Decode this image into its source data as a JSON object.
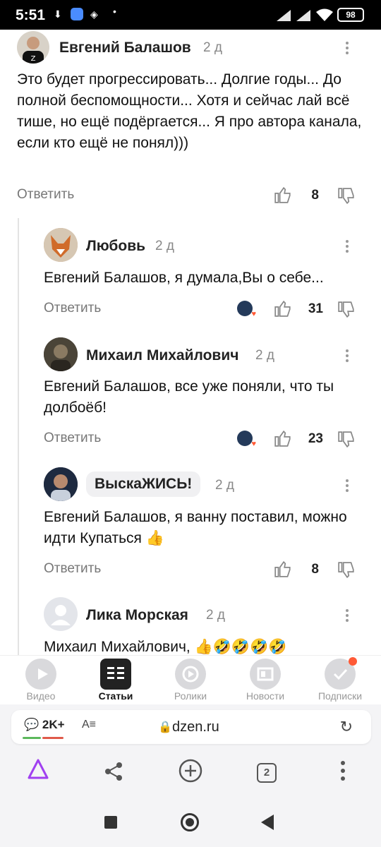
{
  "status_bar": {
    "time": "5:51",
    "battery": "98"
  },
  "comments": [
    {
      "author": "Евгений Балашов",
      "age": "2 д",
      "text": "Это будет прогрессировать... Долгие годы... До полной беспомощности... Хотя и сейчас лай всё тише, но ещё подёргается... Я про автора канала, если кто ещё не понял)))",
      "reply": "Ответить",
      "likes": "8"
    },
    {
      "author": "Любовь",
      "age": "2 д",
      "text": "Евгений Балашов, я думала,Вы о себе...",
      "reply": "Ответить",
      "likes": "31"
    },
    {
      "author": "Михаил Михайлович",
      "age": "2 д",
      "text": "Евгений Балашов, все уже поняли, что ты долбоёб!",
      "reply": "Ответить",
      "likes": "23"
    },
    {
      "author": "ВыскаЖИСЬ!",
      "age": "2 д",
      "text": "Евгений Балашов, я ванну поставил, можно идти Купаться 👍",
      "reply": "Ответить",
      "likes": "8"
    },
    {
      "author": "Лика Морская",
      "age": "2 д",
      "text": "Михаил Михайлович, 👍🤣🤣🤣🤣"
    }
  ],
  "app_nav": {
    "tabs": [
      {
        "label": "Видео",
        "icon": "video-icon"
      },
      {
        "label": "Статьи",
        "icon": "articles-icon",
        "active": true
      },
      {
        "label": "Ролики",
        "icon": "shorts-icon"
      },
      {
        "label": "Новости",
        "icon": "news-icon"
      },
      {
        "label": "Подписки",
        "icon": "subscriptions-icon"
      }
    ]
  },
  "browser": {
    "comments_badge": "2K+",
    "reader_icon": "A≡",
    "domain": "dzen.ru",
    "tabs_count": "2"
  },
  "colors": {
    "accent": "#ff5a36",
    "assistant": "#a040f0"
  }
}
